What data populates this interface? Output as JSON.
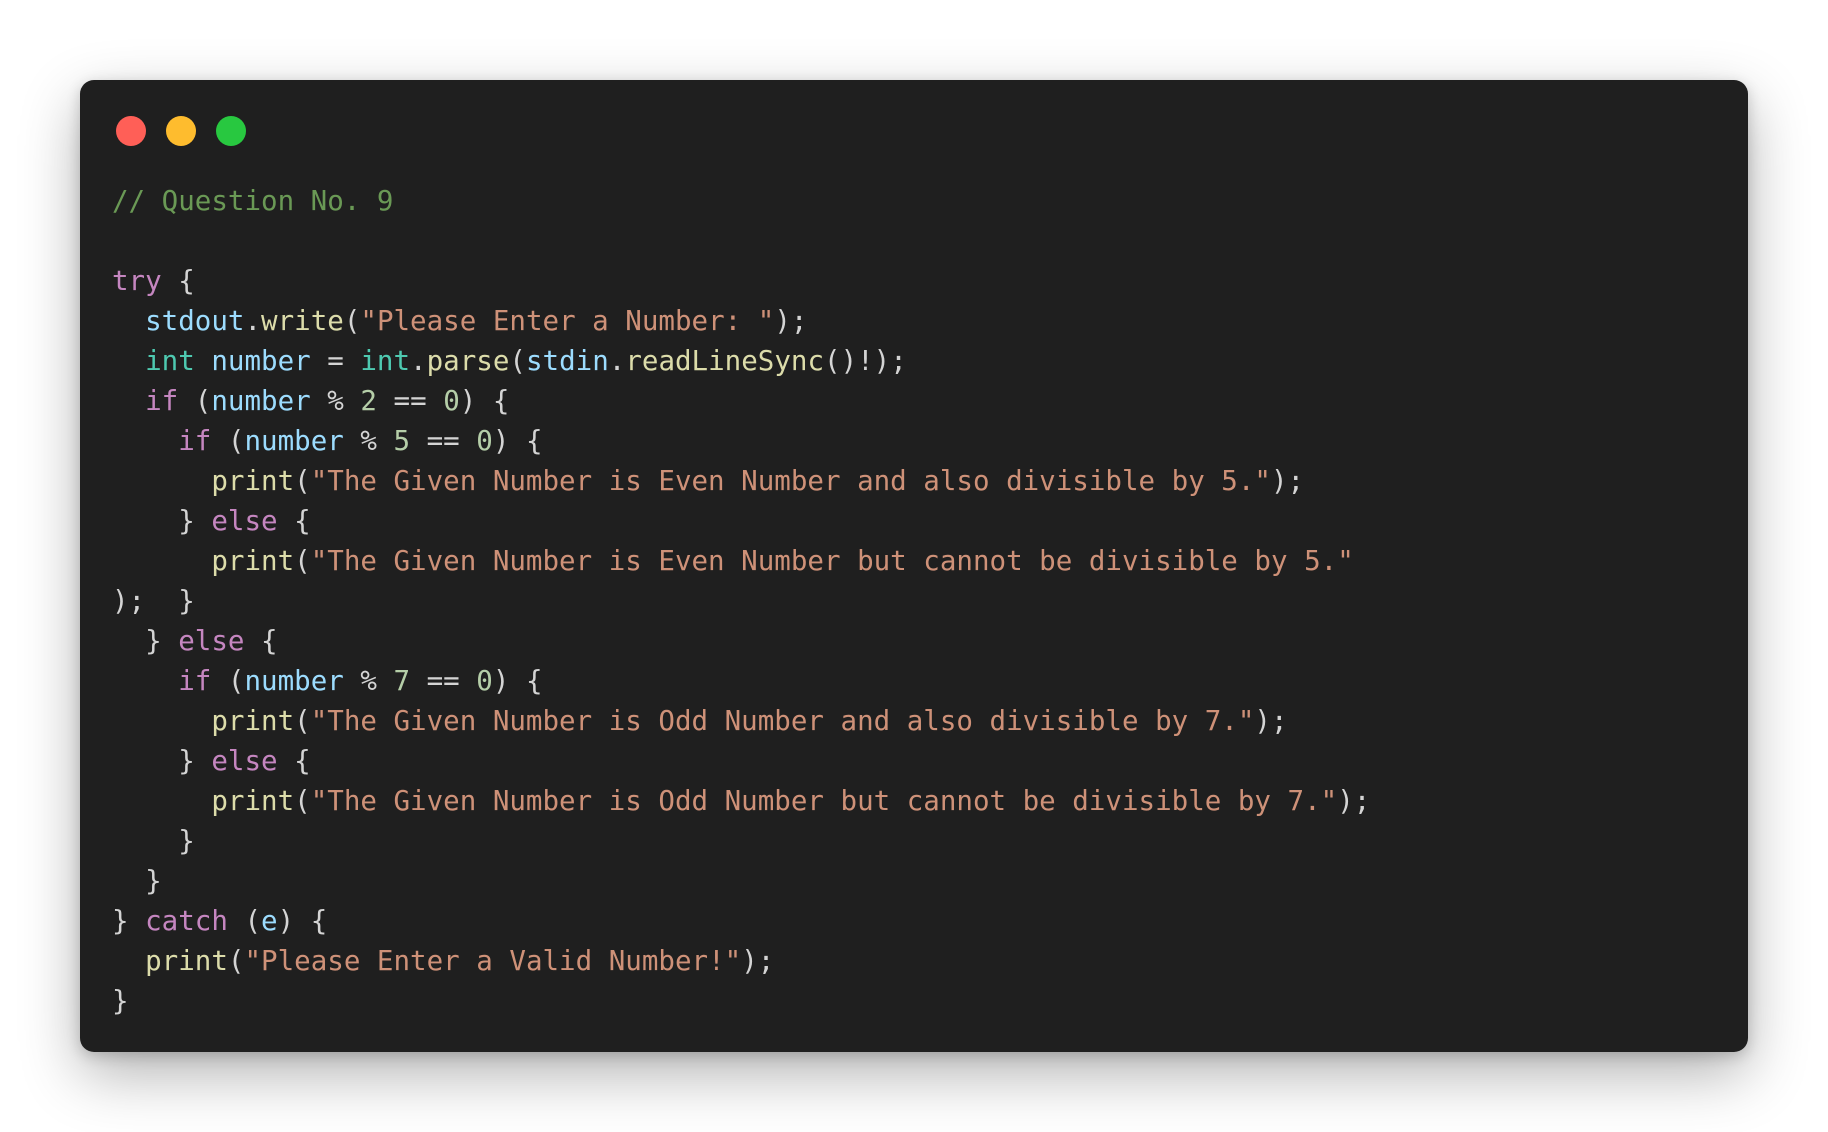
{
  "window": {
    "buttons": [
      {
        "name": "close",
        "color": "#ff5f57"
      },
      {
        "name": "minimize",
        "color": "#febc2e"
      },
      {
        "name": "zoom",
        "color": "#28c840"
      }
    ]
  },
  "theme": {
    "background": "#1f1f1f",
    "comment": "#6a9955",
    "keyword": "#c586c0",
    "type": "#4ec9b0",
    "variable": "#9cdcfe",
    "function": "#dcdcaa",
    "string": "#ce9178",
    "number": "#b5cea8",
    "punct": "#d4d4d4"
  },
  "code_lines": [
    [
      [
        "comment",
        "// Question No. 9"
      ]
    ],
    [],
    [
      [
        "keyword",
        "try"
      ],
      [
        "punct",
        " {"
      ]
    ],
    [
      [
        "punct",
        "  "
      ],
      [
        "variable",
        "stdout"
      ],
      [
        "punct",
        "."
      ],
      [
        "function",
        "write"
      ],
      [
        "punct",
        "("
      ],
      [
        "string",
        "\"Please Enter a Number: \""
      ],
      [
        "punct",
        ");"
      ]
    ],
    [
      [
        "punct",
        "  "
      ],
      [
        "type",
        "int"
      ],
      [
        "punct",
        " "
      ],
      [
        "variable",
        "number"
      ],
      [
        "punct",
        " = "
      ],
      [
        "type",
        "int"
      ],
      [
        "punct",
        "."
      ],
      [
        "function",
        "parse"
      ],
      [
        "punct",
        "("
      ],
      [
        "variable",
        "stdin"
      ],
      [
        "punct",
        "."
      ],
      [
        "function",
        "readLineSync"
      ],
      [
        "punct",
        "()!);"
      ]
    ],
    [
      [
        "punct",
        "  "
      ],
      [
        "keyword",
        "if"
      ],
      [
        "punct",
        " ("
      ],
      [
        "variable",
        "number"
      ],
      [
        "punct",
        " % "
      ],
      [
        "number",
        "2"
      ],
      [
        "punct",
        " == "
      ],
      [
        "number",
        "0"
      ],
      [
        "punct",
        ") {"
      ]
    ],
    [
      [
        "punct",
        "    "
      ],
      [
        "keyword",
        "if"
      ],
      [
        "punct",
        " ("
      ],
      [
        "variable",
        "number"
      ],
      [
        "punct",
        " % "
      ],
      [
        "number",
        "5"
      ],
      [
        "punct",
        " == "
      ],
      [
        "number",
        "0"
      ],
      [
        "punct",
        ") {"
      ]
    ],
    [
      [
        "punct",
        "      "
      ],
      [
        "function",
        "print"
      ],
      [
        "punct",
        "("
      ],
      [
        "string",
        "\"The Given Number is Even Number and also divisible by 5.\""
      ],
      [
        "punct",
        ");"
      ]
    ],
    [
      [
        "punct",
        "    } "
      ],
      [
        "keyword",
        "else"
      ],
      [
        "punct",
        " {"
      ]
    ],
    [
      [
        "punct",
        "      "
      ],
      [
        "function",
        "print"
      ],
      [
        "punct",
        "("
      ],
      [
        "string",
        "\"The Given Number is Even Number but cannot be divisible by 5.\""
      ]
    ],
    [
      [
        "punct",
        ");  }"
      ]
    ],
    [
      [
        "punct",
        "  } "
      ],
      [
        "keyword",
        "else"
      ],
      [
        "punct",
        " {"
      ]
    ],
    [
      [
        "punct",
        "    "
      ],
      [
        "keyword",
        "if"
      ],
      [
        "punct",
        " ("
      ],
      [
        "variable",
        "number"
      ],
      [
        "punct",
        " % "
      ],
      [
        "number",
        "7"
      ],
      [
        "punct",
        " == "
      ],
      [
        "number",
        "0"
      ],
      [
        "punct",
        ") {"
      ]
    ],
    [
      [
        "punct",
        "      "
      ],
      [
        "function",
        "print"
      ],
      [
        "punct",
        "("
      ],
      [
        "string",
        "\"The Given Number is Odd Number and also divisible by 7.\""
      ],
      [
        "punct",
        ");"
      ]
    ],
    [
      [
        "punct",
        "    } "
      ],
      [
        "keyword",
        "else"
      ],
      [
        "punct",
        " {"
      ]
    ],
    [
      [
        "punct",
        "      "
      ],
      [
        "function",
        "print"
      ],
      [
        "punct",
        "("
      ],
      [
        "string",
        "\"The Given Number is Odd Number but cannot be divisible by 7.\""
      ],
      [
        "punct",
        ");"
      ]
    ],
    [
      [
        "punct",
        "    }"
      ]
    ],
    [
      [
        "punct",
        "  }"
      ]
    ],
    [
      [
        "punct",
        "} "
      ],
      [
        "keyword",
        "catch"
      ],
      [
        "punct",
        " ("
      ],
      [
        "variable",
        "e"
      ],
      [
        "punct",
        ") {"
      ]
    ],
    [
      [
        "punct",
        "  "
      ],
      [
        "function",
        "print"
      ],
      [
        "punct",
        "("
      ],
      [
        "string",
        "\"Please Enter a Valid Number!\""
      ],
      [
        "punct",
        ");"
      ]
    ],
    [
      [
        "punct",
        "}"
      ]
    ]
  ]
}
